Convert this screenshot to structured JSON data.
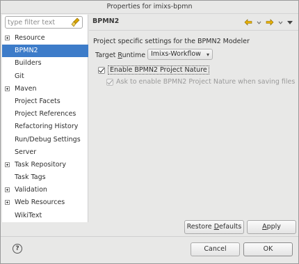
{
  "window": {
    "title": "Properties for imixs-bpmn"
  },
  "filter": {
    "placeholder": "type filter text"
  },
  "tree": [
    {
      "label": "Resource",
      "expandable": true,
      "selected": false
    },
    {
      "label": "BPMN2",
      "expandable": false,
      "selected": true
    },
    {
      "label": "Builders",
      "expandable": false,
      "selected": false
    },
    {
      "label": "Git",
      "expandable": false,
      "selected": false
    },
    {
      "label": "Maven",
      "expandable": true,
      "selected": false
    },
    {
      "label": "Project Facets",
      "expandable": false,
      "selected": false
    },
    {
      "label": "Project References",
      "expandable": false,
      "selected": false
    },
    {
      "label": "Refactoring History",
      "expandable": false,
      "selected": false
    },
    {
      "label": "Run/Debug Settings",
      "expandable": false,
      "selected": false
    },
    {
      "label": "Server",
      "expandable": false,
      "selected": false
    },
    {
      "label": "Task Repository",
      "expandable": true,
      "selected": false
    },
    {
      "label": "Task Tags",
      "expandable": false,
      "selected": false
    },
    {
      "label": "Validation",
      "expandable": true,
      "selected": false
    },
    {
      "label": "Web Resources",
      "expandable": true,
      "selected": false
    },
    {
      "label": "WikiText",
      "expandable": false,
      "selected": false
    }
  ],
  "page": {
    "title": "BPMN2",
    "description": "Project specific settings for the BPMN2 Modeler",
    "runtime_label": "Target Runtime",
    "runtime_value": "Imixs-Workflow",
    "enable_label": "Enable BPMN2 Project Nature",
    "enable_checked": true,
    "ask_label": "Ask to enable BPMN2 Project Nature when saving files",
    "ask_checked": true
  },
  "buttons": {
    "restore_defaults": "Restore Defaults",
    "apply": "Apply",
    "cancel": "Cancel",
    "ok": "OK"
  },
  "icons": {
    "broom": "clear-filter-icon",
    "back": "back-arrow-icon",
    "forward": "forward-arrow-icon",
    "help": "help-icon"
  },
  "colors": {
    "selection": "#3d7cc9",
    "accent_arrow": "#e8b000"
  }
}
